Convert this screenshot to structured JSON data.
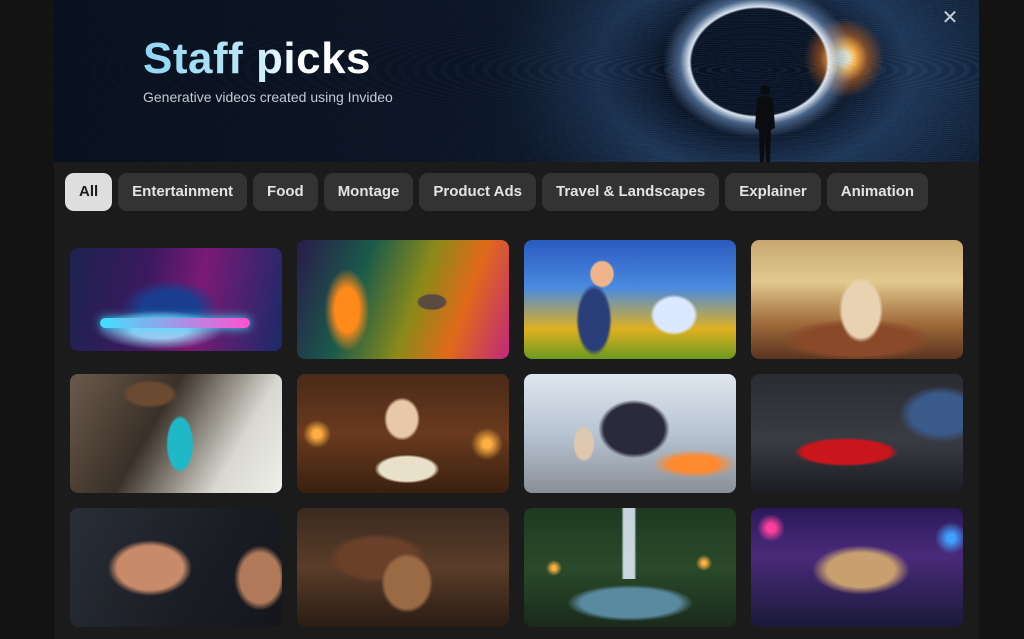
{
  "hero": {
    "title": "Staff picks",
    "subtitle": "Generative videos created using Invideo",
    "close_icon": "close-icon"
  },
  "filters": [
    {
      "label": "All",
      "active": true
    },
    {
      "label": "Entertainment",
      "active": false
    },
    {
      "label": "Food",
      "active": false
    },
    {
      "label": "Montage",
      "active": false
    },
    {
      "label": "Product Ads",
      "active": false
    },
    {
      "label": "Travel & Landscapes",
      "active": false
    },
    {
      "label": "Explainer",
      "active": false
    },
    {
      "label": "Animation",
      "active": false
    }
  ],
  "videos": [
    {
      "subject": "neon sneaker"
    },
    {
      "subject": "hummingbird and flower"
    },
    {
      "subject": "cartoon couple in front of house"
    },
    {
      "subject": "gods in a temple"
    },
    {
      "subject": "teal water bottle"
    },
    {
      "subject": "woman reading by candlelight"
    },
    {
      "subject": "fighter versus monster"
    },
    {
      "subject": "red vintage car in garage"
    },
    {
      "subject": "hands close-up"
    },
    {
      "subject": "pottery wheel"
    },
    {
      "subject": "forest waterfall"
    },
    {
      "subject": "food truck at night"
    }
  ],
  "colors": {
    "background": "#131313",
    "panel": "#1b1b1b",
    "chip": "#333333",
    "chip_active": "#dedede",
    "title_gradient_start": "#8fd7f5"
  }
}
